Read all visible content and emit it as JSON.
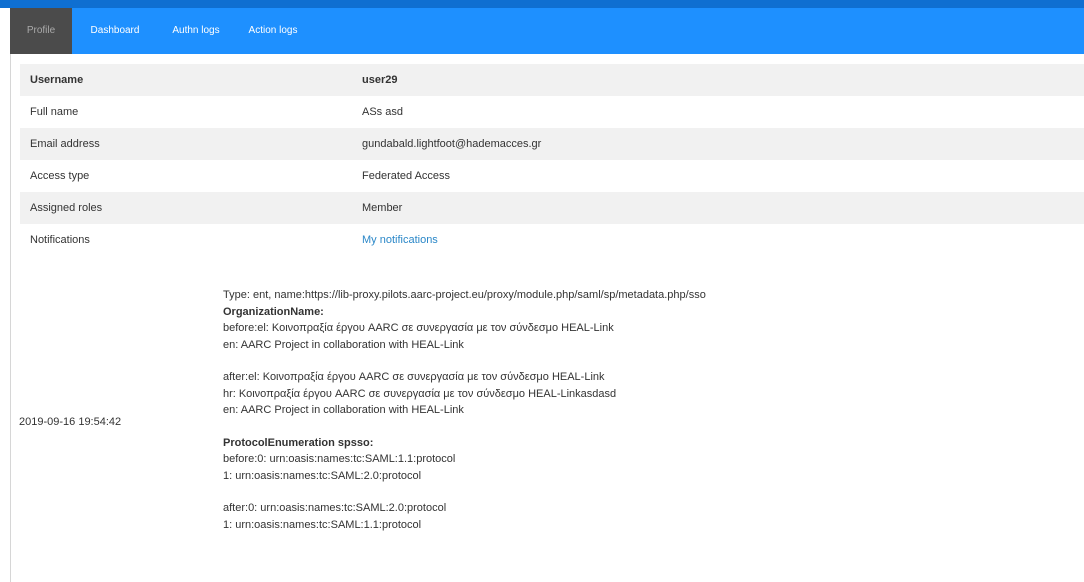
{
  "nav": {
    "tabs": [
      {
        "label": "Profile",
        "active": true
      },
      {
        "label": "Dashboard",
        "active": false
      },
      {
        "label": "Authn logs",
        "active": false
      },
      {
        "label": "Action logs",
        "active": false
      }
    ]
  },
  "profile": {
    "header": {
      "label": "Username",
      "value": "user29"
    },
    "rows": [
      {
        "label": "Full name",
        "value": "ASs asd"
      },
      {
        "label": "Email address",
        "value": "gundabald.lightfoot@hademacces.gr"
      },
      {
        "label": "Access type",
        "value": "Federated Access"
      },
      {
        "label": "Assigned roles",
        "value": "Member"
      },
      {
        "label": "Notifications",
        "value": "My notifications"
      }
    ]
  },
  "action_log": {
    "date": "2019-09-16 19:54:42",
    "type_line": "Type: ent, name:https://lib-proxy.pilots.aarc-project.eu/proxy/module.php/saml/sp/metadata.php/sso",
    "org_heading": "OrganizationName:",
    "org_before": [
      "before:el: Κοινοπραξία έργου AARC σε συνεργασία με τον σύνδεσμο HEAL-Link",
      "en: AARC Project in collaboration with HEAL-Link"
    ],
    "org_after": [
      "after:el: Κοινοπραξία έργου AARC σε συνεργασία με τον σύνδεσμο HEAL-Link",
      "hr: Κοινοπραξία έργου AARC σε συνεργασία με τον σύνδεσμο HEAL-Linkasdasd",
      "en: AARC Project in collaboration with HEAL-Link"
    ],
    "proto_heading": "ProtocolEnumeration spsso:",
    "proto_before": [
      "before:0: urn:oasis:names:tc:SAML:1.1:protocol",
      "1: urn:oasis:names:tc:SAML:2.0:protocol"
    ],
    "proto_after": [
      "after:0: urn:oasis:names:tc:SAML:2.0:protocol",
      "1: urn:oasis:names:tc:SAML:1.1:protocol"
    ]
  },
  "colors": {
    "navbar": "#1e90ff",
    "active_tab": "#4b4b4b",
    "link": "#2a87c8",
    "stripe": "#f1f1f1"
  }
}
